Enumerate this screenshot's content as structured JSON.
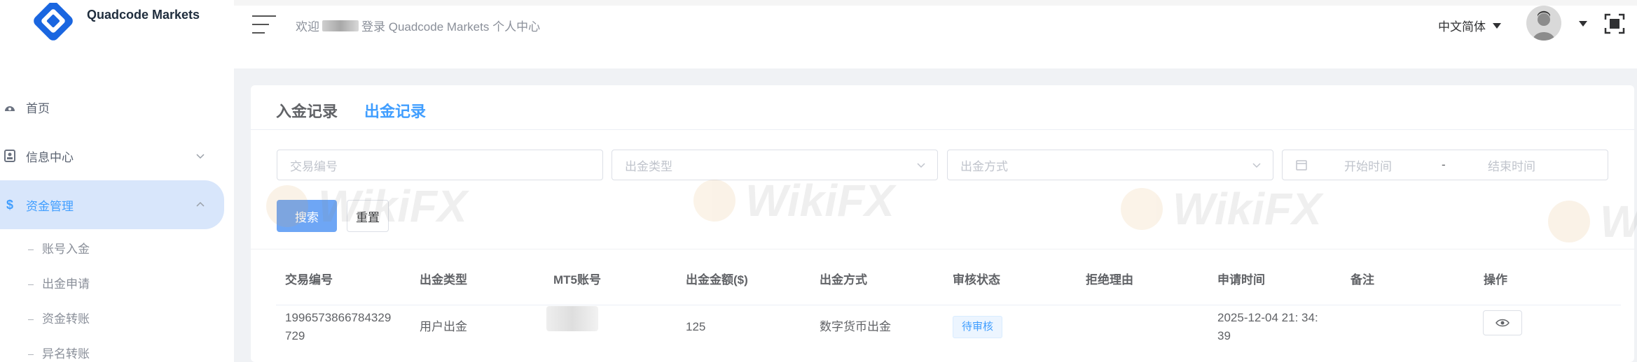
{
  "brand": {
    "name": "Quadcode Markets"
  },
  "header": {
    "welcome_prefix": "欢迎",
    "welcome_suffix": "登录 Quadcode Markets 个人中心",
    "language": "中文简体"
  },
  "sidebar": {
    "items": [
      {
        "label": "首页",
        "icon": "dashboard-icon"
      },
      {
        "label": "信息中心",
        "icon": "id-card-icon"
      },
      {
        "label": "资金管理",
        "icon": "dollar-icon"
      }
    ],
    "sub_items": [
      "账号入金",
      "出金申请",
      "资金转账",
      "异名转账"
    ]
  },
  "tabs": {
    "deposit": "入金记录",
    "withdraw": "出金记录",
    "active": "出金记录"
  },
  "filters": {
    "trade_no_placeholder": "交易编号",
    "type_placeholder": "出金类型",
    "method_placeholder": "出金方式",
    "start_placeholder": "开始时间",
    "end_placeholder": "结束时间",
    "range_separator": "-"
  },
  "buttons": {
    "search": "搜索",
    "reset": "重置"
  },
  "table": {
    "columns": [
      "交易编号",
      "出金类型",
      "MT5账号",
      "出金金额($)",
      "出金方式",
      "审核状态",
      "拒绝理由",
      "申请时间",
      "备注",
      "操作"
    ],
    "rows": [
      {
        "trade_no_line1": "1996573866784329",
        "trade_no_line2": "729",
        "type": "用户出金",
        "amount": "125",
        "method": "数字货币出金",
        "status": "待审核",
        "reject_reason": "",
        "time_line1": "2025-12-04 21: 34:",
        "time_line2": "39",
        "remark": ""
      }
    ]
  },
  "watermark": "WikiFX",
  "colors": {
    "accent": "#409eff",
    "active_bg": "#d8e6fb",
    "primary_btn": "#6ea6f5"
  }
}
